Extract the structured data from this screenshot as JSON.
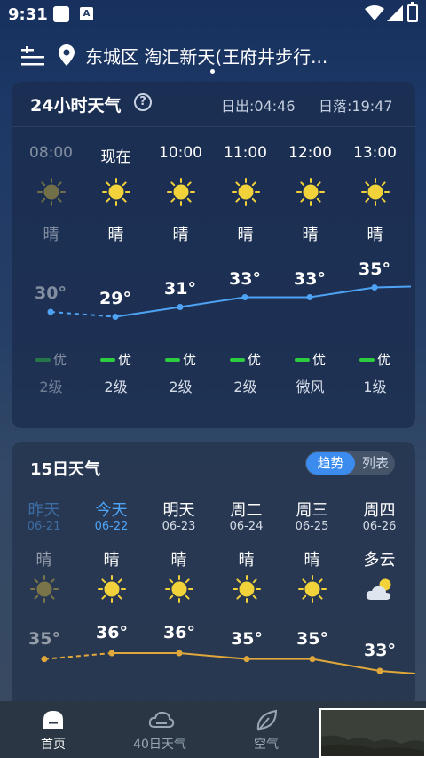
{
  "status_bar": {
    "time": "9:31",
    "notif_letter": "A"
  },
  "header": {
    "location": "东城区 淘汇新天(王府井步行..."
  },
  "hourly": {
    "title": "24小时天气",
    "sunrise": "日出:04:46",
    "sunset": "日落:19:47",
    "items": [
      {
        "time": "08:00",
        "cond": "晴",
        "temp": "30°",
        "aqi": "优",
        "wind": "2级"
      },
      {
        "time": "现在",
        "cond": "晴",
        "temp": "29°",
        "aqi": "优",
        "wind": "2级"
      },
      {
        "time": "10:00",
        "cond": "晴",
        "temp": "31°",
        "aqi": "优",
        "wind": "2级"
      },
      {
        "time": "11:00",
        "cond": "晴",
        "temp": "33°",
        "aqi": "优",
        "wind": "2级"
      },
      {
        "time": "12:00",
        "cond": "晴",
        "temp": "33°",
        "aqi": "优",
        "wind": "微风"
      },
      {
        "time": "13:00",
        "cond": "晴",
        "temp": "35°",
        "aqi": "优",
        "wind": "1级"
      }
    ]
  },
  "daily": {
    "title": "15日天气",
    "toggle_trend": "趋势",
    "toggle_list": "列表",
    "items": [
      {
        "name": "昨天",
        "date": "06-21",
        "cond": "晴",
        "temp": "35°",
        "icon": "sun-icon"
      },
      {
        "name": "今天",
        "date": "06-22",
        "cond": "晴",
        "temp": "36°",
        "icon": "sun-icon"
      },
      {
        "name": "明天",
        "date": "06-23",
        "cond": "晴",
        "temp": "36°",
        "icon": "sun-icon"
      },
      {
        "name": "周二",
        "date": "06-24",
        "cond": "晴",
        "temp": "35°",
        "icon": "sun-icon"
      },
      {
        "name": "周三",
        "date": "06-25",
        "cond": "晴",
        "temp": "35°",
        "icon": "sun-icon"
      },
      {
        "name": "周四",
        "date": "06-26",
        "cond": "多云",
        "temp": "33°",
        "icon": "partly-cloudy-icon"
      }
    ]
  },
  "nav": {
    "home": "首页",
    "forecast40": "40日天气",
    "air": "空气"
  },
  "colors": {
    "accent_blue": "#3c8cf0",
    "aqi_green": "#2ecc40",
    "hourly_line": "#4ea3f5",
    "daily_line": "#e0a83a",
    "sun": "#f2d23a"
  }
}
